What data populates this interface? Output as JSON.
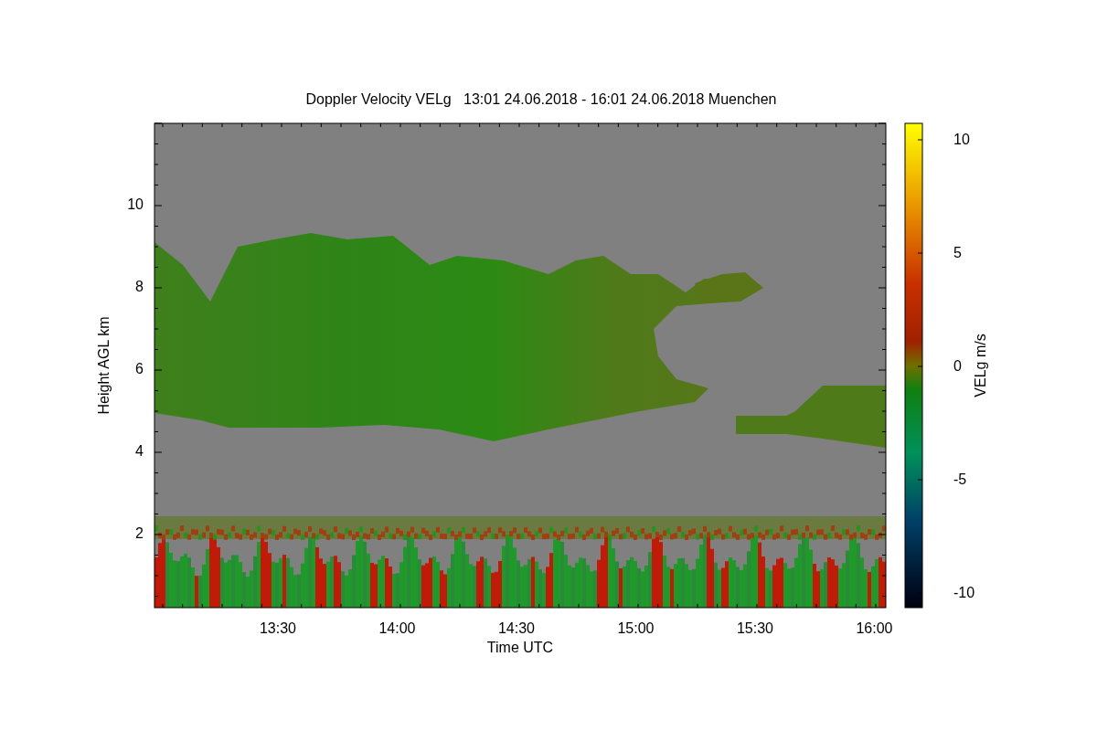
{
  "plot": {
    "title": "Doppler Velocity VELg   13:01 24.06.2018 - 16:01 24.06.2018 Muenchen",
    "xlabel": "Time UTC",
    "ylabel": "Height AGL km",
    "xticks": [
      "13:30",
      "14:00",
      "14:30",
      "15:00",
      "15:30",
      "16:00"
    ],
    "yticks": [
      "10",
      "8",
      "6",
      "4",
      "2"
    ]
  },
  "colorbar": {
    "label": "VELg m/s",
    "ticks": [
      "10",
      "5",
      "0",
      "-5",
      "-10"
    ]
  }
}
